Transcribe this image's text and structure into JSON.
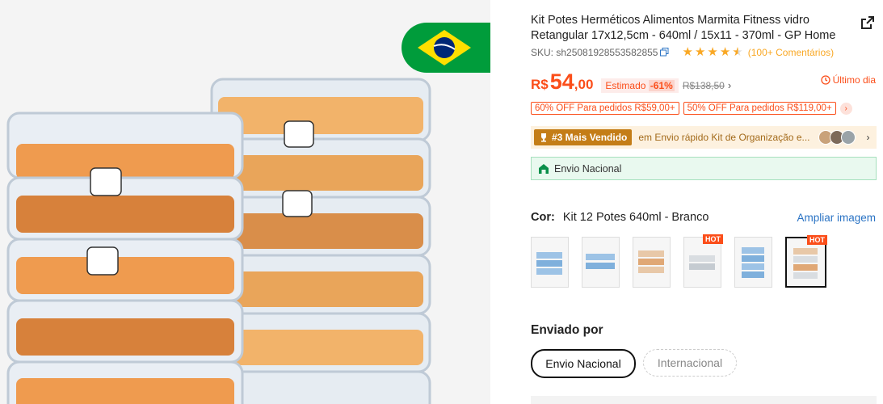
{
  "product": {
    "title": "Kit Potes Herméticos Alimentos Marmita Fitness vidro Retangular 17x12,5cm - 640ml / 15x11 - 370ml - GP Home",
    "share_icon": "share-external-icon",
    "sku": "SKU: sh25081928553582855",
    "copy_icon": "copy-icon",
    "rating": 4.5,
    "reviews": "(100+ Comentários)"
  },
  "price": {
    "currency": "R$",
    "integer": "54",
    "decimal": ",00",
    "estimado_label": "Estimado",
    "discount": "-61%",
    "original": "R$138,50",
    "chevron": "›",
    "ultimo": "Último dia"
  },
  "coupons": [
    "60% OFF Para pedidos R$59,00+",
    "50% OFF Para pedidos R$119,00+"
  ],
  "coupon_more": "›",
  "bestseller": {
    "tag": "#3 Mais Vendido",
    "text": "em Envio rápido Kit de Organização e...",
    "chevron": "›"
  },
  "envio_box": {
    "label": "Envio Nacional"
  },
  "color": {
    "label": "Cor:",
    "value": "Kit 12 Potes 640ml - Branco",
    "ampliar": "Ampliar imagem",
    "hot_label": "HOT",
    "thumbnails": [
      {
        "hot": false,
        "selected": false
      },
      {
        "hot": false,
        "selected": false
      },
      {
        "hot": false,
        "selected": false
      },
      {
        "hot": true,
        "selected": false
      },
      {
        "hot": false,
        "selected": false
      },
      {
        "hot": true,
        "selected": true
      }
    ]
  },
  "shipping": {
    "label": "Enviado por",
    "options": [
      "Envio Nacional",
      "Internacional"
    ],
    "selected": "Envio Nacional"
  },
  "colors": {
    "accent": "#fb4e1a",
    "star": "#f9a825",
    "link": "#2a73c4",
    "flag_green": "#009c3b",
    "flag_yellow": "#ffdf00",
    "flag_blue": "#002776"
  }
}
